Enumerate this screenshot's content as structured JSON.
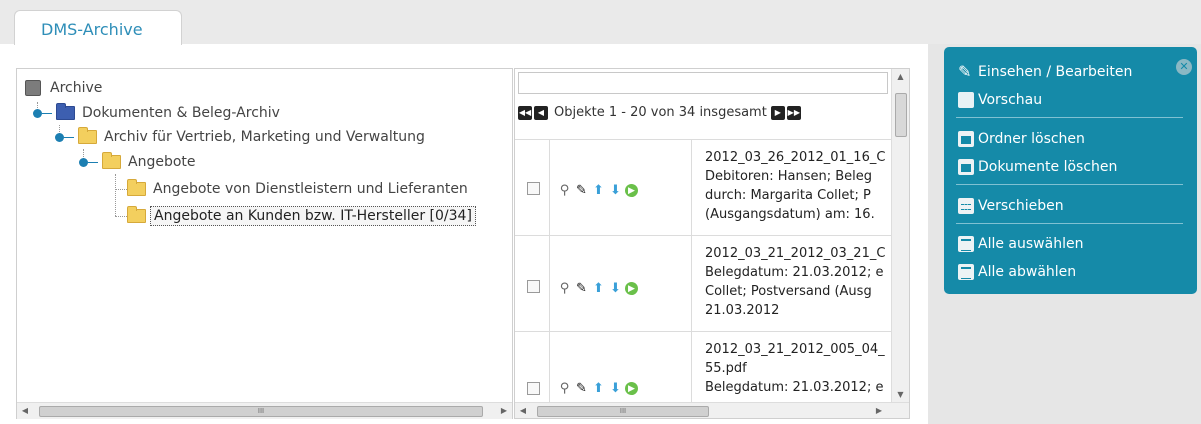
{
  "tab": {
    "label": "DMS-Archive"
  },
  "tree": {
    "items": [
      {
        "label": "Archive"
      },
      {
        "label": "Dokumenten & Beleg-Archiv"
      },
      {
        "label": "Archiv für Vertrieb, Marketing und Verwaltung"
      },
      {
        "label": "Angebote"
      },
      {
        "label": "Angebote von Dienstleistern und Lieferanten"
      },
      {
        "label": "Angebote an Kunden bzw. IT-Hersteller [0/34]"
      }
    ],
    "scroll_thumb": "III"
  },
  "list": {
    "filter_value": "",
    "pager_text": "Objekte 1 - 20 von 34 insgesamt",
    "scroll_thumb": "III",
    "rows": [
      {
        "lines": [
          "2012_03_26_2012_01_16_C",
          "Debitoren: Hansen; Beleg",
          "durch: Margarita Collet; P",
          "(Ausgangsdatum) am: 16."
        ]
      },
      {
        "lines": [
          "2012_03_21_2012_03_21_C",
          "Belegdatum: 21.03.2012; e",
          "Collet; Postversand (Ausg",
          "21.03.2012"
        ]
      },
      {
        "lines": [
          "2012_03_21_2012_005_04_",
          "55.pdf",
          "Belegdatum: 21.03.2012; e"
        ]
      }
    ]
  },
  "actions": {
    "view_edit": "Einsehen / Bearbeiten",
    "preview": "Vorschau",
    "delete_folder": "Ordner löschen",
    "delete_documents": "Dokumente löschen",
    "move": "Verschieben",
    "select_all": "Alle auswählen",
    "deselect_all": "Alle abwählen"
  },
  "colors": {
    "accent": "#158aa8",
    "tab_text": "#2e8eb8"
  }
}
